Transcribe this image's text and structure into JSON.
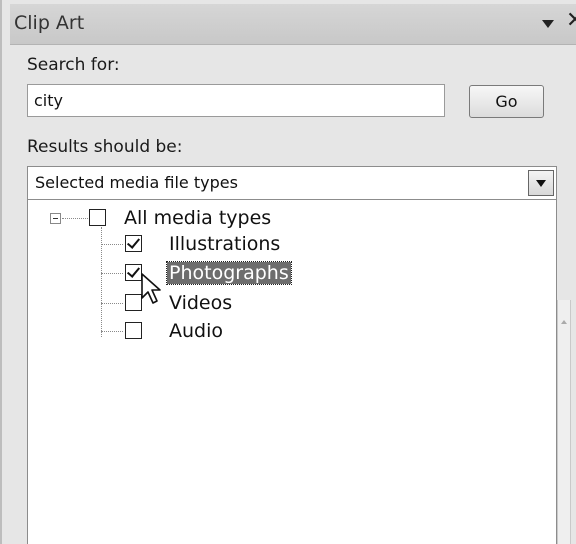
{
  "pane": {
    "title": "Clip Art",
    "dropdown_icon": "chevron-down-icon",
    "close_icon": "close-icon"
  },
  "search": {
    "label": "Search for:",
    "value": "city",
    "go_label": "Go"
  },
  "results": {
    "label": "Results should be:",
    "selected": "Selected media file types"
  },
  "media_tree": {
    "root": {
      "label": "All media types",
      "checked": false,
      "expanded": true
    },
    "items": [
      {
        "label": "Illustrations",
        "checked": true
      },
      {
        "label": "Photographs",
        "checked": true,
        "selected": true
      },
      {
        "label": "Videos",
        "checked": false
      },
      {
        "label": "Audio",
        "checked": false
      }
    ]
  }
}
